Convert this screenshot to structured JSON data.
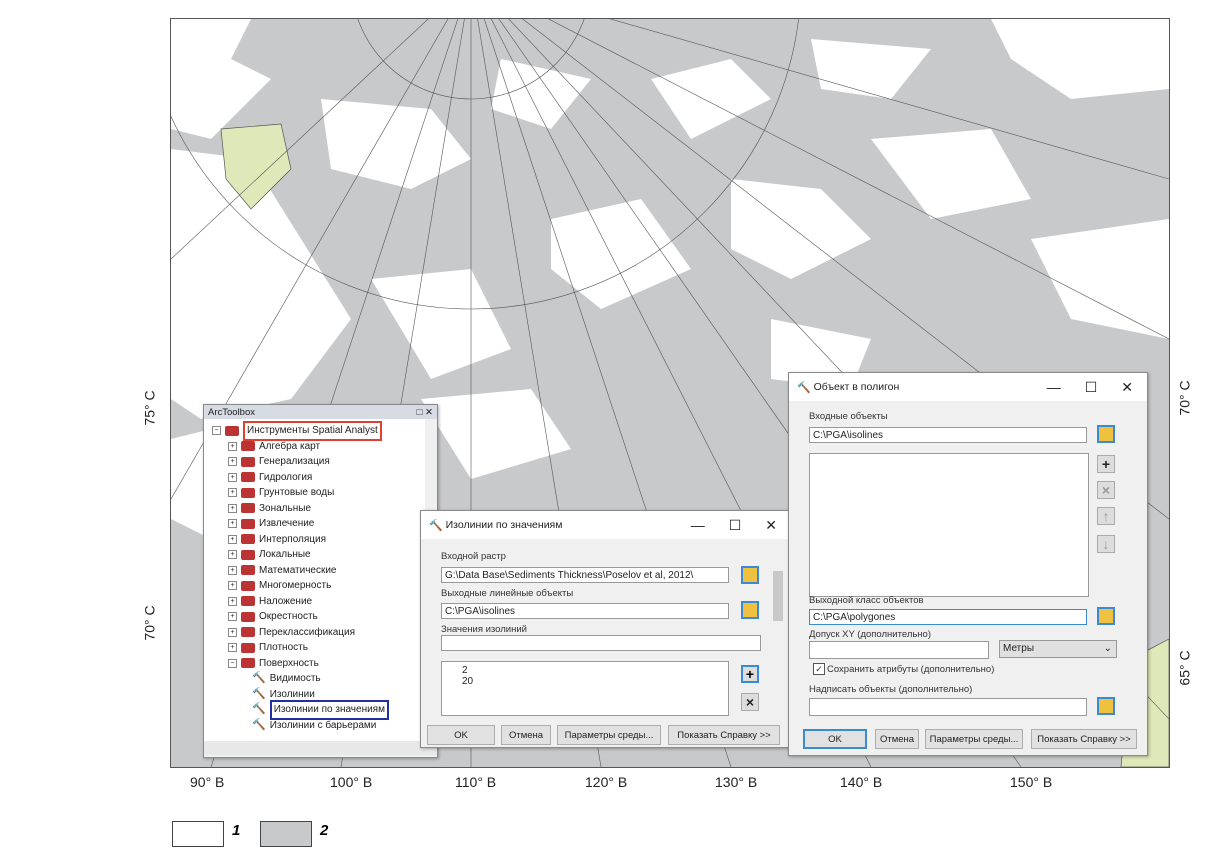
{
  "map": {
    "colors": {
      "land": "#e8f0d0",
      "zone1": "#ffffff",
      "zone2": "#c8c9cb",
      "island": "#dfe8b8"
    },
    "x_labels": [
      "90° В",
      "100° В",
      "110° В",
      "120° В",
      "130° В",
      "140° В",
      "150° В"
    ],
    "left_labels": [
      "75° С",
      "70° С"
    ],
    "right_labels": [
      "70° С",
      "65° С"
    ]
  },
  "legend": [
    {
      "label": "1",
      "color": "#ffffff"
    },
    {
      "label": "2",
      "color": "#c8c9cb"
    }
  ],
  "toolbox": {
    "title": "ArcToolbox",
    "root": "Инструменты Spatial Analyst",
    "items": [
      "Алгебра карт",
      "Генерализация",
      "Гидрология",
      "Грунтовые воды",
      "Зональные",
      "Извлечение",
      "Интерполяция",
      "Локальные",
      "Математические",
      "Многомерность",
      "Наложение",
      "Окрестность",
      "Переклассификация",
      "Плотность",
      "Поверхность"
    ],
    "subitems": [
      "Видимость",
      "Изолинии",
      "Изолинии по значениям",
      "Изолинии с барьерами"
    ]
  },
  "contour": {
    "title": "Изолинии по значениям",
    "input_raster_label": "Входной растр",
    "input_raster": "G:\\Data Base\\Sediments Thickness\\Poselov et al, 2012\\",
    "output_label": "Выходные линейные объекты",
    "output": "C:\\PGA\\isolines",
    "values_label": "Значения изолиний",
    "values_input": "",
    "values": [
      "2",
      "20"
    ],
    "buttons": [
      "OK",
      "Отмена",
      "Параметры среды...",
      "Показать Справку >>"
    ]
  },
  "f2p": {
    "title": "Объект в полигон",
    "input_label": "Входные объекты",
    "input": "C:\\PGA\\isolines",
    "output_label": "Выходной класс объектов",
    "output": "C:\\PGA\\polygones",
    "tolerance_label": "Допуск XY (дополнительно)",
    "tolerance": "",
    "units": "Метры",
    "preserve_label": "Сохранить атрибуты (дополнительно)",
    "preserve_checked": true,
    "label_features_label": "Надписать объекты (дополнительно)",
    "label_features": "",
    "buttons": [
      "OK",
      "Отмена",
      "Параметры среды...",
      "Показать Справку >>"
    ]
  }
}
